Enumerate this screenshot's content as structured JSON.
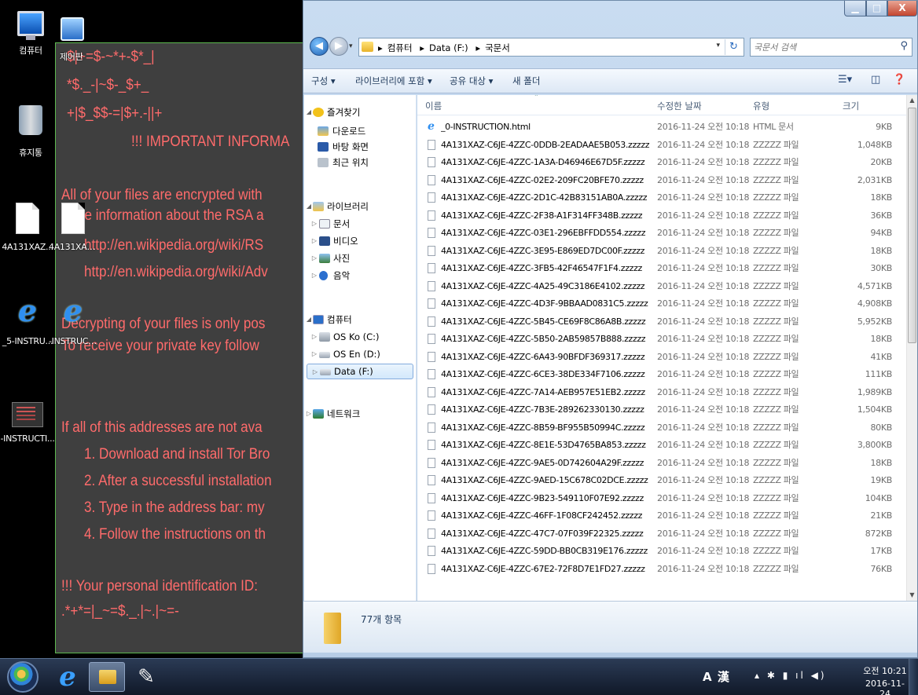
{
  "desktop": {
    "icons": [
      {
        "label": "컴퓨터"
      },
      {
        "label": "제어판"
      },
      {
        "label": "휴지통"
      },
      {
        "label": "4A131XAZ..."
      },
      {
        "label": "4A131XAZ..."
      },
      {
        "label": "_5-INSTRU..."
      },
      {
        "label": "-INSTRUCTI..."
      },
      {
        "label": "-INSTRUCTI..."
      }
    ]
  },
  "ransom_note": {
    "lines": [
      "$|+=$-~*+-$*_|",
      "*$._-|~$-_$+_",
      "+|$_$$-=|$+.-||+",
      "!!! IMPORTANT INFORMA",
      "All of your files are encrypted with",
      "More information about the RSA a",
      "http://en.wikipedia.org/wiki/RS",
      "http://en.wikipedia.org/wiki/Adv",
      "Decrypting of your files is only pos",
      "To receive your private key follow",
      "If all of this addresses are not ava",
      "1. Download and install Tor Bro",
      "2. After a successful installation",
      "3. Type in the address bar: my",
      "4. Follow the instructions on th",
      "!!! Your personal identification ID:",
      ".*+*=|_~=$._.|~.|~=-"
    ]
  },
  "explorer": {
    "breadcrumb": [
      "컴퓨터",
      "Data (F:)",
      "국문서"
    ],
    "search_placeholder": "국문서 검색",
    "toolbar": {
      "organize": "구성 ▾",
      "include_in_library": "라이브러리에 포함 ▾",
      "share_with": "공유 대상 ▾",
      "new_folder": "새 폴더"
    },
    "nav": {
      "favorites": "즐겨찾기",
      "downloads": "다운로드",
      "desktop": "바탕 화면",
      "recent": "최근 위치",
      "libraries": "라이브러리",
      "documents": "문서",
      "videos": "비디오",
      "pictures": "사진",
      "music": "음악",
      "computer": "컴퓨터",
      "drive_c": "OS Ko (C:)",
      "drive_d": "OS En (D:)",
      "drive_f": "Data (F:)",
      "network": "네트워크"
    },
    "columns": {
      "name": "이름",
      "modified": "수정한 날짜",
      "type": "유형",
      "size": "크기"
    },
    "files": [
      {
        "name": "_0-INSTRUCTION.html",
        "date": "2016-11-24 오전 10:18",
        "type": "HTML 문서",
        "size": "9KB"
      },
      {
        "name": "4A131XAZ-C6JE-4ZZC-0DDB-2EADAAE5B053.zzzzz",
        "date": "2016-11-24 오전 10:18",
        "type": "ZZZZZ 파일",
        "size": "1,048KB"
      },
      {
        "name": "4A131XAZ-C6JE-4ZZC-1A3A-D46946E67D5F.zzzzz",
        "date": "2016-11-24 오전 10:18",
        "type": "ZZZZZ 파일",
        "size": "20KB"
      },
      {
        "name": "4A131XAZ-C6JE-4ZZC-02E2-209FC20BFE70.zzzzz",
        "date": "2016-11-24 오전 10:18",
        "type": "ZZZZZ 파일",
        "size": "2,031KB"
      },
      {
        "name": "4A131XAZ-C6JE-4ZZC-2D1C-42B83151AB0A.zzzzz",
        "date": "2016-11-24 오전 10:18",
        "type": "ZZZZZ 파일",
        "size": "18KB"
      },
      {
        "name": "4A131XAZ-C6JE-4ZZC-2F38-A1F314FF348B.zzzzz",
        "date": "2016-11-24 오전 10:18",
        "type": "ZZZZZ 파일",
        "size": "36KB"
      },
      {
        "name": "4A131XAZ-C6JE-4ZZC-03E1-296EBFFDD554.zzzzz",
        "date": "2016-11-24 오전 10:18",
        "type": "ZZZZZ 파일",
        "size": "94KB"
      },
      {
        "name": "4A131XAZ-C6JE-4ZZC-3E95-E869ED7DC00F.zzzzz",
        "date": "2016-11-24 오전 10:18",
        "type": "ZZZZZ 파일",
        "size": "18KB"
      },
      {
        "name": "4A131XAZ-C6JE-4ZZC-3FB5-42F46547F1F4.zzzzz",
        "date": "2016-11-24 오전 10:18",
        "type": "ZZZZZ 파일",
        "size": "30KB"
      },
      {
        "name": "4A131XAZ-C6JE-4ZZC-4A25-49C3186E4102.zzzzz",
        "date": "2016-11-24 오전 10:18",
        "type": "ZZZZZ 파일",
        "size": "4,571KB"
      },
      {
        "name": "4A131XAZ-C6JE-4ZZC-4D3F-9BBAAD0831C5.zzzzz",
        "date": "2016-11-24 오전 10:18",
        "type": "ZZZZZ 파일",
        "size": "4,908KB"
      },
      {
        "name": "4A131XAZ-C6JE-4ZZC-5B45-CE69F8C86A8B.zzzzz",
        "date": "2016-11-24 오전 10:18",
        "type": "ZZZZZ 파일",
        "size": "5,952KB"
      },
      {
        "name": "4A131XAZ-C6JE-4ZZC-5B50-2AB59857B888.zzzzz",
        "date": "2016-11-24 오전 10:18",
        "type": "ZZZZZ 파일",
        "size": "18KB"
      },
      {
        "name": "4A131XAZ-C6JE-4ZZC-6A43-90BFDF369317.zzzzz",
        "date": "2016-11-24 오전 10:18",
        "type": "ZZZZZ 파일",
        "size": "41KB"
      },
      {
        "name": "4A131XAZ-C6JE-4ZZC-6CE3-38DE334F7106.zzzzz",
        "date": "2016-11-24 오전 10:18",
        "type": "ZZZZZ 파일",
        "size": "111KB"
      },
      {
        "name": "4A131XAZ-C6JE-4ZZC-7A14-AEB957E51EB2.zzzzz",
        "date": "2016-11-24 오전 10:18",
        "type": "ZZZZZ 파일",
        "size": "1,989KB"
      },
      {
        "name": "4A131XAZ-C6JE-4ZZC-7B3E-289262330130.zzzzz",
        "date": "2016-11-24 오전 10:18",
        "type": "ZZZZZ 파일",
        "size": "1,504KB"
      },
      {
        "name": "4A131XAZ-C6JE-4ZZC-8B59-BF955B50994C.zzzzz",
        "date": "2016-11-24 오전 10:18",
        "type": "ZZZZZ 파일",
        "size": "80KB"
      },
      {
        "name": "4A131XAZ-C6JE-4ZZC-8E1E-53D4765BA853.zzzzz",
        "date": "2016-11-24 오전 10:18",
        "type": "ZZZZZ 파일",
        "size": "3,800KB"
      },
      {
        "name": "4A131XAZ-C6JE-4ZZC-9AE5-0D742604A29F.zzzzz",
        "date": "2016-11-24 오전 10:18",
        "type": "ZZZZZ 파일",
        "size": "18KB"
      },
      {
        "name": "4A131XAZ-C6JE-4ZZC-9AED-15C678C02DCE.zzzzz",
        "date": "2016-11-24 오전 10:18",
        "type": "ZZZZZ 파일",
        "size": "19KB"
      },
      {
        "name": "4A131XAZ-C6JE-4ZZC-9B23-549110F07E92.zzzzz",
        "date": "2016-11-24 오전 10:18",
        "type": "ZZZZZ 파일",
        "size": "104KB"
      },
      {
        "name": "4A131XAZ-C6JE-4ZZC-46FF-1F08CF242452.zzzzz",
        "date": "2016-11-24 오전 10:18",
        "type": "ZZZZZ 파일",
        "size": "21KB"
      },
      {
        "name": "4A131XAZ-C6JE-4ZZC-47C7-07F039F22325.zzzzz",
        "date": "2016-11-24 오전 10:18",
        "type": "ZZZZZ 파일",
        "size": "872KB"
      },
      {
        "name": "4A131XAZ-C6JE-4ZZC-59DD-BB0CB319E176.zzzzz",
        "date": "2016-11-24 오전 10:18",
        "type": "ZZZZZ 파일",
        "size": "17KB"
      },
      {
        "name": "4A131XAZ-C6JE-4ZZC-67E2-72F8D7E1FD27.zzzzz",
        "date": "2016-11-24 오전 10:18",
        "type": "ZZZZZ 파일",
        "size": "76KB"
      }
    ],
    "item_count": "77개 항목"
  },
  "taskbar": {
    "ime": "A 漢",
    "time": "오전 10:21",
    "date": "2016-11-24"
  },
  "colors": {
    "note_text": "#ff6b6b",
    "note_background": "#3f3f3f",
    "note_border": "#5db94f"
  }
}
